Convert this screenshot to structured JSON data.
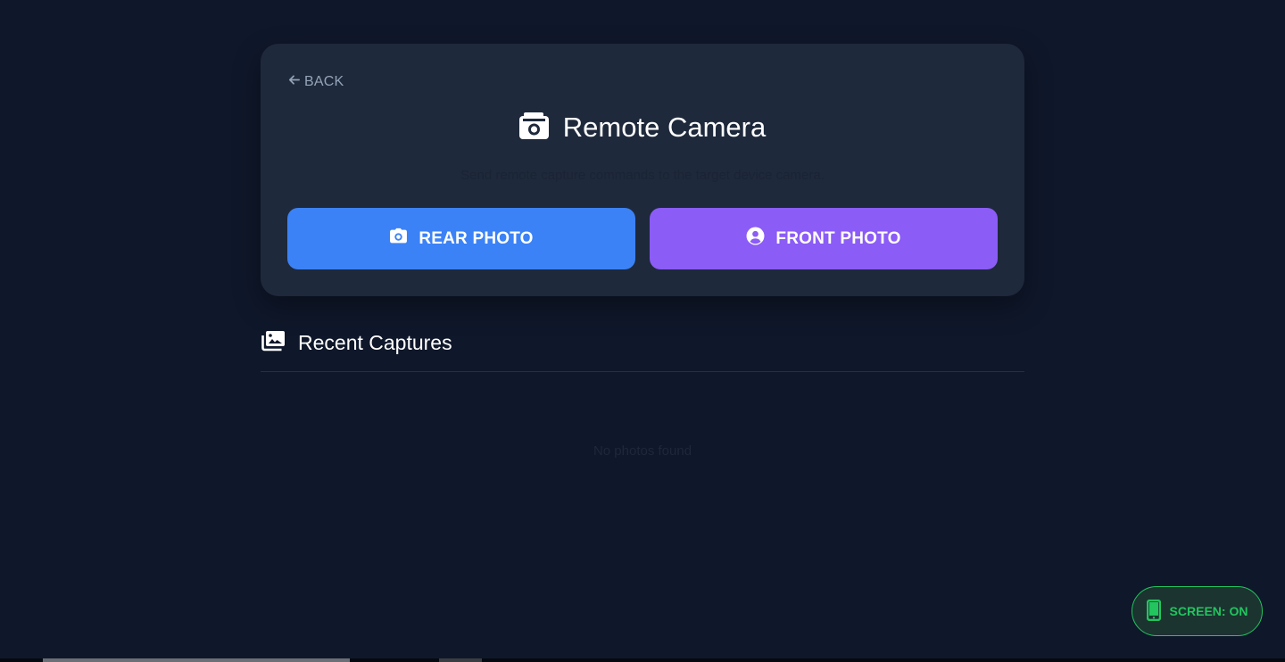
{
  "nav": {
    "back_label": "BACK"
  },
  "header": {
    "title": "Remote Camera",
    "subtitle": "Send remote capture commands to the target device camera."
  },
  "actions": {
    "rear_label": "REAR PHOTO",
    "front_label": "FRONT PHOTO"
  },
  "captures": {
    "title": "Recent Captures",
    "empty_text": "No photos found"
  },
  "screen_status": {
    "label": "SCREEN: ON"
  },
  "icons": {
    "back": "arrow-left-icon",
    "title": "camera-rotate-icon",
    "rear": "camera-icon",
    "front": "user-circle-icon",
    "captures": "images-icon",
    "screen": "mobile-phone-icon"
  },
  "colors": {
    "background": "#0f172a",
    "card": "#1e293b",
    "rear_button": "#3b82f6",
    "front_button": "#8b5cf6",
    "screen_on": "#22c55e",
    "muted_text": "#94a3b8"
  }
}
